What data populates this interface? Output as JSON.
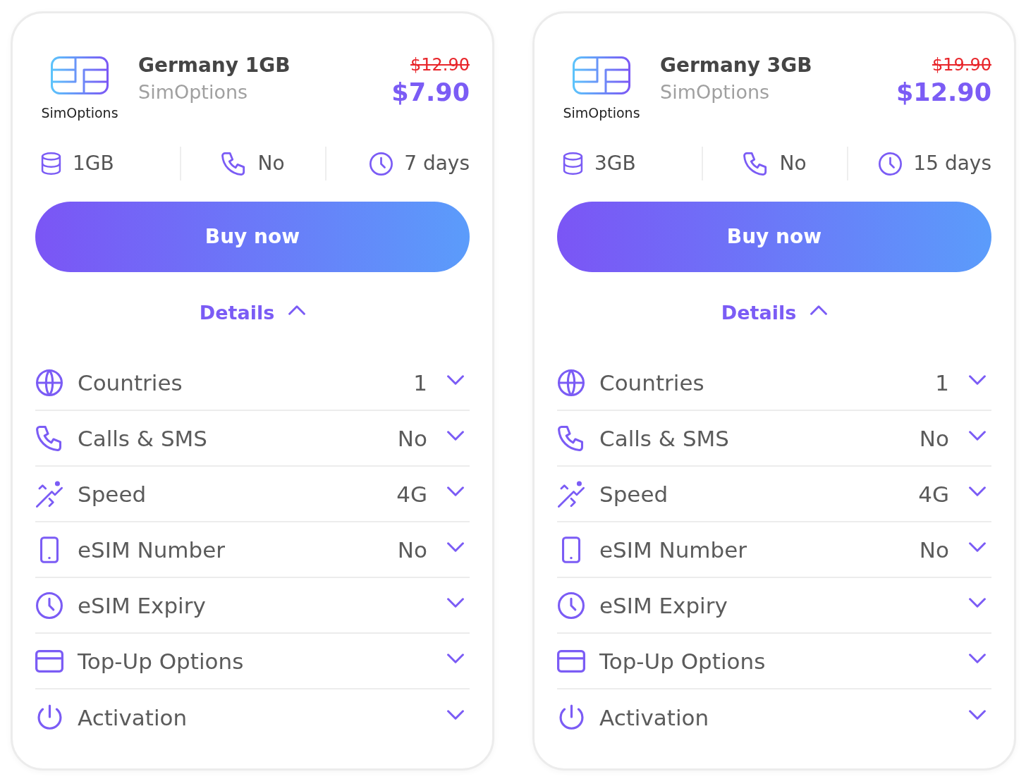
{
  "plans": [
    {
      "logo_label": "SimOptions",
      "title": "Germany 1GB",
      "provider": "SimOptions",
      "old_price": "$12.90",
      "price": "$7.90",
      "stats": [
        {
          "kind": "data",
          "value": "1GB"
        },
        {
          "kind": "calls",
          "value": "No"
        },
        {
          "kind": "duration",
          "value": "7 days"
        }
      ],
      "buy_button": "Buy now",
      "details": {
        "label": "Details",
        "expanded": true
      },
      "features": [
        {
          "kind": "countries",
          "label": "Countries",
          "value": "1",
          "expanded": false
        },
        {
          "kind": "calls",
          "label": "Calls & SMS",
          "value": "No",
          "expanded": false
        },
        {
          "kind": "speed",
          "label": "Speed",
          "value": "4G",
          "expanded": false
        },
        {
          "kind": "number",
          "label": "eSIM Number",
          "value": "No",
          "expanded": false
        },
        {
          "kind": "expiry",
          "label": "eSIM Expiry",
          "expanded": false
        },
        {
          "kind": "topup",
          "label": "Top-Up Options",
          "expanded": false
        },
        {
          "kind": "activation",
          "label": "Activation",
          "expanded": false
        }
      ]
    },
    {
      "logo_label": "SimOptions",
      "title": "Germany 3GB",
      "provider": "SimOptions",
      "old_price": "$19.90",
      "price": "$12.90",
      "stats": [
        {
          "kind": "data",
          "value": "3GB"
        },
        {
          "kind": "calls",
          "value": "No"
        },
        {
          "kind": "duration",
          "value": "15 days"
        }
      ],
      "buy_button": "Buy now",
      "details": {
        "label": "Details",
        "expanded": true
      },
      "features": [
        {
          "kind": "countries",
          "label": "Countries",
          "value": "1",
          "expanded": false
        },
        {
          "kind": "calls",
          "label": "Calls & SMS",
          "value": "No",
          "expanded": false
        },
        {
          "kind": "speed",
          "label": "Speed",
          "value": "4G",
          "expanded": false
        },
        {
          "kind": "number",
          "label": "eSIM Number",
          "value": "No",
          "expanded": false
        },
        {
          "kind": "expiry",
          "label": "eSIM Expiry",
          "expanded": false
        },
        {
          "kind": "topup",
          "label": "Top-Up Options",
          "expanded": false
        },
        {
          "kind": "activation",
          "label": "Activation",
          "expanded": false
        }
      ]
    }
  ]
}
